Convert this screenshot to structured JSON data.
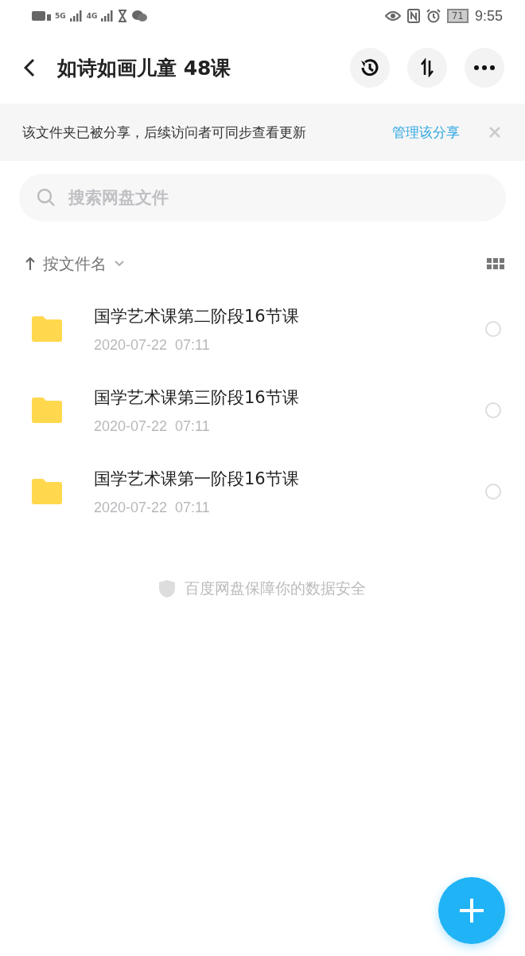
{
  "status_bar": {
    "network_1": "5G",
    "network_2": "4G",
    "battery": "71",
    "time": "9:55"
  },
  "header": {
    "title": "如诗如画儿童 48课"
  },
  "share_banner": {
    "text": "该文件夹已被分享，后续访问者可同步查看更新",
    "link": "管理该分享"
  },
  "search": {
    "placeholder": "搜索网盘文件"
  },
  "sort": {
    "label": "按文件名"
  },
  "files": [
    {
      "name": "国学艺术课第二阶段16节课",
      "date": "2020-07-22  07:11",
      "selected": false
    },
    {
      "name": "国学艺术课第三阶段16节课",
      "date": "2020-07-22  07:11",
      "selected": false
    },
    {
      "name": "国学艺术课第一阶段16节课",
      "date": "2020-07-22  07:11",
      "selected": false
    }
  ],
  "footer": {
    "text": "百度网盘保障你的数据安全"
  }
}
